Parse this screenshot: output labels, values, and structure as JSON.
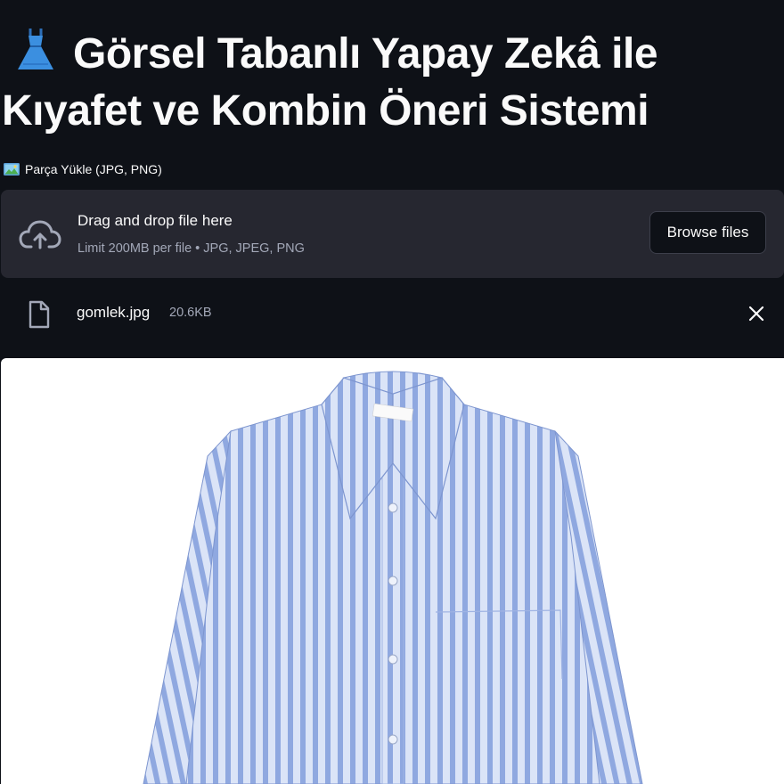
{
  "header": {
    "title_icon": "dress-icon",
    "title": "Görsel Tabanlı Yapay Zekâ ile Kıyafet ve Kombin Öneri Sistemi"
  },
  "uploader": {
    "label_icon": "framed-picture-icon",
    "label": "Parça Yükle (JPG, PNG)",
    "drop_title": "Drag and drop file here",
    "drop_limit": "Limit 200MB per file • JPG, JPEG, PNG",
    "browse_label": "Browse files"
  },
  "uploaded_file": {
    "name": "gomlek.jpg",
    "size": "20.6KB"
  },
  "preview": {
    "description_icon": "striped-shirt-image",
    "shirt_colors": {
      "stripe": "#8fa8e0",
      "base": "#dbe4f7"
    }
  },
  "colors": {
    "background": "#0e1117",
    "dropzone": "#262730",
    "muted_text": "#a3a8b8"
  }
}
